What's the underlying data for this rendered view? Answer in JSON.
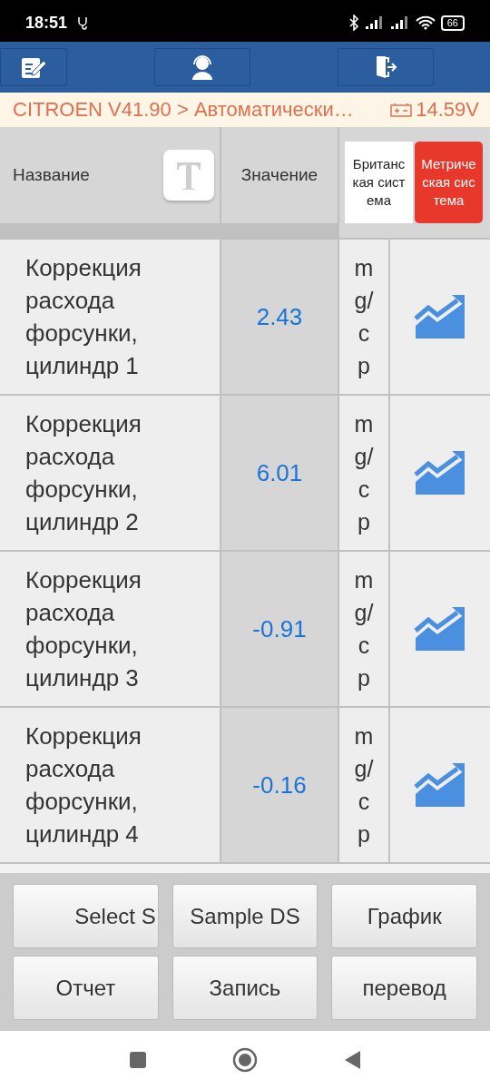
{
  "status_bar": {
    "time": "18:51",
    "battery": "66"
  },
  "breadcrumb": {
    "path": "CITROEN V41.90 > Автоматически…",
    "voltage": "14.59V"
  },
  "header": {
    "name": "Название",
    "value": "Значение",
    "units": [
      {
        "label": "Британская система",
        "selected": false
      },
      {
        "label": "Метрическая система",
        "selected": true
      }
    ]
  },
  "rows": [
    {
      "name": "Коррекция расхода форсунки, цилиндр 1",
      "value": "2.43",
      "unit": "mg/cp"
    },
    {
      "name": "Коррекция расхода форсунки, цилиндр 2",
      "value": "6.01",
      "unit": "mg/cp"
    },
    {
      "name": "Коррекция расхода форсунки, цилиндр 3",
      "value": "-0.91",
      "unit": "mg/cp"
    },
    {
      "name": "Коррекция расхода форсунки, цилиндр 4",
      "value": "-0.16",
      "unit": "mg/cp"
    }
  ],
  "buttons": [
    "Select S",
    "Sample DS",
    "График",
    "Отчет",
    "Запись",
    "перевод"
  ]
}
